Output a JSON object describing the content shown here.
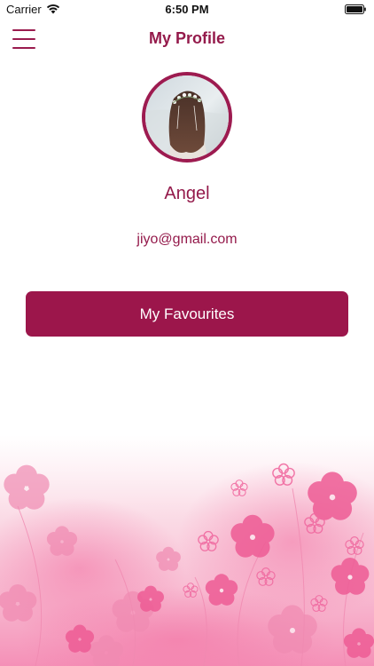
{
  "status_bar": {
    "carrier": "Carrier",
    "time": "6:50 PM",
    "icons": [
      "wifi-icon",
      "battery-icon"
    ]
  },
  "nav": {
    "title": "My Profile",
    "menu_icon": "hamburger-menu-icon"
  },
  "profile": {
    "name": "Angel",
    "email": "jiyo@gmail.com",
    "avatar": "profile-photo-girl-with-flower-crown"
  },
  "actions": {
    "favourites_label": "My Favourites"
  },
  "colors": {
    "accent": "#941a4b",
    "button": "#9c164b",
    "decor_pink": "#ee5c95",
    "background": "#ffffff"
  }
}
